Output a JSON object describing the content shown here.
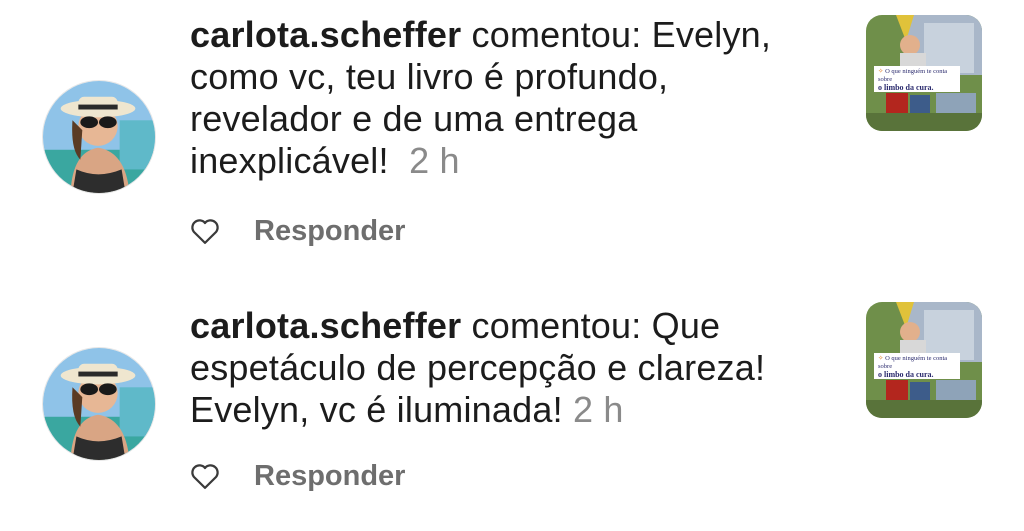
{
  "notifications": [
    {
      "username": "carlota.scheffer",
      "message": " comentou: Evelyn, como vc, teu livro é profundo, revelador e de uma entrega inexplicável!",
      "time": "2 h",
      "reply_label": "Responder",
      "post_caption_line1": "O que ninguém te conta sobre",
      "post_caption_line2": "o limbo da cura."
    },
    {
      "username": "carlota.scheffer",
      "message": " comentou: Que espetáculo de percepção e clareza! Evelyn, vc é iluminada!",
      "time": "2 h",
      "reply_label": "Responder",
      "post_caption_line1": "O que ninguém te conta sobre",
      "post_caption_line2": "o limbo da cura."
    }
  ],
  "colors": {
    "text": "#1c1c1c",
    "muted": "#8a8a8a",
    "reply": "#6e6e6e"
  },
  "icons": [
    "heart-icon"
  ]
}
